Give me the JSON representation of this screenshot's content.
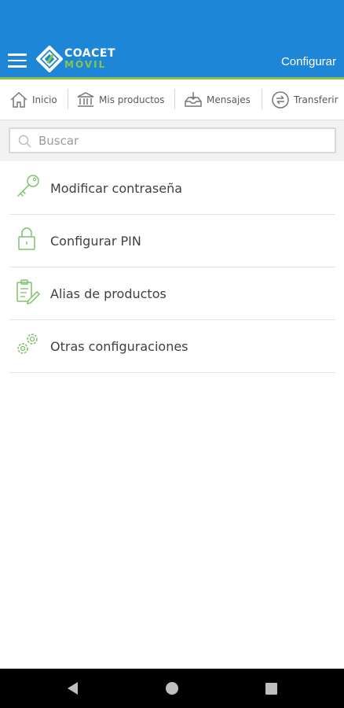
{
  "header": {
    "logo_line1": "COACET",
    "logo_line2": "MÓVIL",
    "right_link": "Configurar"
  },
  "tabs": [
    {
      "label": "Inicio",
      "icon": "home-icon"
    },
    {
      "label": "Mis productos",
      "icon": "bank-icon"
    },
    {
      "label": "Mensajes",
      "icon": "inbox-icon"
    },
    {
      "label": "Transferir",
      "icon": "transfer-icon"
    }
  ],
  "search": {
    "placeholder": "Buscar"
  },
  "menu_items": [
    {
      "label": "Modificar contraseña",
      "icon": "key-icon"
    },
    {
      "label": "Configurar PIN",
      "icon": "lock-icon"
    },
    {
      "label": "Alias de productos",
      "icon": "clipboard-edit-icon"
    },
    {
      "label": "Otras configuraciones",
      "icon": "gears-icon"
    }
  ],
  "colors": {
    "header_bg": "#1e86d6",
    "accent_green": "#8bc34a",
    "icon_green": "#7cc26a"
  }
}
